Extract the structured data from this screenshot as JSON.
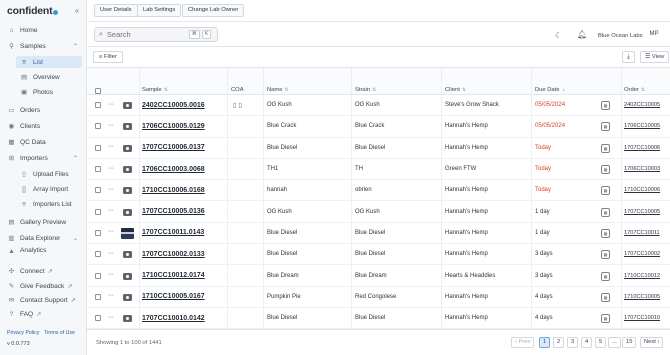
{
  "app": {
    "logo_text": "confident"
  },
  "sidebar": {
    "items": [
      {
        "label": "Home",
        "icon": "home-icon"
      },
      {
        "label": "Samples",
        "icon": "samples-icon"
      },
      {
        "label": "Orders",
        "icon": "orders-icon"
      },
      {
        "label": "Clients",
        "icon": "clients-icon"
      },
      {
        "label": "QC Data",
        "icon": "qc-icon"
      },
      {
        "label": "Importers",
        "icon": "importers-icon"
      },
      {
        "label": "Gallery Preview",
        "icon": "gallery-icon"
      },
      {
        "label": "Data Explorer",
        "icon": "data-explorer-icon"
      },
      {
        "label": "Analytics",
        "icon": "analytics-icon"
      },
      {
        "label": "Connect",
        "icon": "connect-icon"
      },
      {
        "label": "Give Feedback",
        "icon": "feedback-icon"
      },
      {
        "label": "Contact Support",
        "icon": "support-icon"
      },
      {
        "label": "FAQ",
        "icon": "faq-icon"
      }
    ],
    "samples_sub": [
      {
        "label": "List",
        "icon": "list-icon"
      },
      {
        "label": "Overview",
        "icon": "overview-icon"
      },
      {
        "label": "Photos",
        "icon": "photos-icon"
      }
    ],
    "importers_sub": [
      {
        "label": "Upload Files",
        "icon": "file-icon"
      },
      {
        "label": "Array Import",
        "icon": "array-icon"
      },
      {
        "label": "Importers List",
        "icon": "list-icon"
      }
    ],
    "privacy": "Privacy Policy",
    "terms": "Terms of Use",
    "version": "v 0.0.773"
  },
  "topbar": {
    "buttons": [
      "User Details",
      "Lab Settings",
      "Change Lab Owner"
    ]
  },
  "search": {
    "placeholder": "Search",
    "shortcut_mod": "⌘",
    "shortcut_key": "K",
    "org_name": "Blue Ocean Labs",
    "avatar_initials": "MP"
  },
  "toolbar": {
    "filter_label": "Filter",
    "view_label": "View"
  },
  "table": {
    "headers": {
      "sample": "Sample",
      "coa": "COA",
      "name": "Name",
      "strain": "Strain",
      "client": "Client",
      "due_date": "Due Date",
      "order": "Order"
    },
    "rows": [
      {
        "sample": "2402CC10005.0016",
        "name": "OG Kush",
        "strain": "OG Kush",
        "client": "Steve's Grow Shack",
        "due": "05/05/2024",
        "due_status": "overdue",
        "order": "2402CC10005",
        "coa": true,
        "thumb": false
      },
      {
        "sample": "1706CC10005.0129",
        "name": "Blue Crack",
        "strain": "Blue Crack",
        "client": "Hannah's Hemp",
        "due": "05/05/2024",
        "due_status": "overdue",
        "order": "1706CC10005",
        "coa": false,
        "thumb": false
      },
      {
        "sample": "1707CC10006.0137",
        "name": "Blue Diesel",
        "strain": "Blue Diesel",
        "client": "Hannah's Hemp",
        "due": "Today",
        "due_status": "overdue",
        "order": "1707CC10006",
        "coa": false,
        "thumb": false
      },
      {
        "sample": "1706CC10003.0068",
        "name": "TH1",
        "strain": "TH",
        "client": "Green FTW",
        "due": "Today",
        "due_status": "overdue",
        "order": "1706CC10003",
        "coa": false,
        "thumb": false
      },
      {
        "sample": "1710CC10006.0168",
        "name": "hannah",
        "strain": "obrien",
        "client": "Hannah's Hemp",
        "due": "Today",
        "due_status": "overdue",
        "order": "1710CC10006",
        "coa": false,
        "thumb": false
      },
      {
        "sample": "1707CC10005.0136",
        "name": "OG Kush",
        "strain": "OG Kush",
        "client": "Hannah's Hemp",
        "due": "1 day",
        "due_status": "normal",
        "order": "1707CC10005",
        "coa": false,
        "thumb": false
      },
      {
        "sample": "1707CC10011.0143",
        "name": "Blue Diesel",
        "strain": "Blue Diesel",
        "client": "Hannah's Hemp",
        "due": "1 day",
        "due_status": "normal",
        "order": "1707CC10011",
        "coa": false,
        "thumb": true
      },
      {
        "sample": "1707CC10002.0133",
        "name": "Blue Diesel",
        "strain": "Blue Diesel",
        "client": "Hannah's Hemp",
        "due": "3 days",
        "due_status": "normal",
        "order": "1707CC10002",
        "coa": false,
        "thumb": false
      },
      {
        "sample": "1710CC10012.0174",
        "name": "Blue Dream",
        "strain": "Blue Dream",
        "client": "Hearts & Headdies",
        "due": "3 days",
        "due_status": "normal",
        "order": "1710CC10012",
        "coa": false,
        "thumb": false
      },
      {
        "sample": "1710CC10005.0167",
        "name": "Pumpkin Pie",
        "strain": "Red Congolese",
        "client": "Hannah's Hemp",
        "due": "4 days",
        "due_status": "normal",
        "order": "1710CC10005",
        "coa": false,
        "thumb": false
      },
      {
        "sample": "1707CC10010.0142",
        "name": "Blue Diesel",
        "strain": "Blue Diesel",
        "client": "Hannah's Hemp",
        "due": "4 days",
        "due_status": "normal",
        "order": "1707CC10010",
        "coa": false,
        "thumb": false
      }
    ]
  },
  "footer": {
    "showing": "Showing 1 to 100 of 1441",
    "prev": "Prev",
    "next": "Next",
    "pages": [
      "1",
      "2",
      "3",
      "4",
      "5",
      "...",
      "15"
    ],
    "current_page": "1"
  },
  "colors": {
    "accent": "#2563a8",
    "overdue": "#d63c2f",
    "active_bg": "#dbe8f6"
  }
}
